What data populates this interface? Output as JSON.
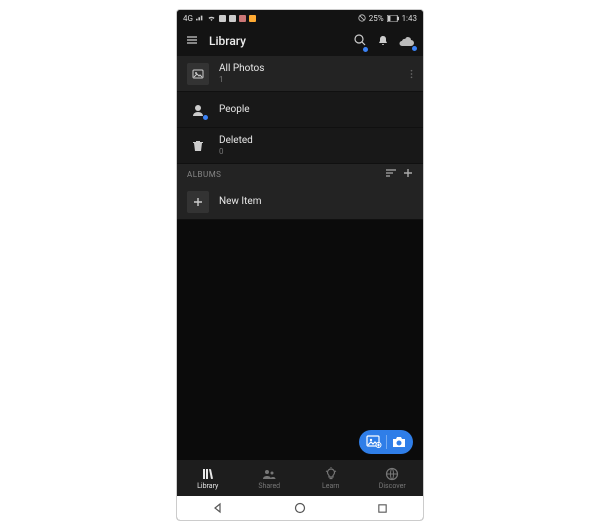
{
  "statusbar": {
    "carrier": "4G",
    "battery": "25%",
    "time": "1:43"
  },
  "header": {
    "title": "Library"
  },
  "list": {
    "all_photos": {
      "label": "All Photos",
      "count": "1"
    },
    "people": {
      "label": "People"
    },
    "deleted": {
      "label": "Deleted",
      "count": "0"
    }
  },
  "albums": {
    "heading": "ALBUMS",
    "new_item": {
      "label": "New Item"
    }
  },
  "bottomnav": {
    "library": "Library",
    "shared": "Shared",
    "learn": "Learn",
    "discover": "Discover"
  }
}
